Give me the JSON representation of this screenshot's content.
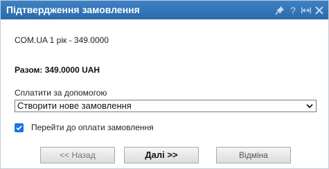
{
  "dialog": {
    "title": "Підтвердження замовлення",
    "icons": [
      "pin-icon",
      "help-icon",
      "resize-icon",
      "close-icon"
    ],
    "help_glyph": "?"
  },
  "order": {
    "product_line": "COM.UA 1 рік - 349.0000",
    "total": "Разом: 349.0000 UAH"
  },
  "payment": {
    "label": "Сплатити за допомогою",
    "selected_option": "Створити нове замовлення"
  },
  "proceed": {
    "label": "Перейти до оплати замовлення",
    "checked": true
  },
  "buttons": {
    "back": "<< Назад",
    "next": "Далі >>",
    "cancel": "Відміна"
  },
  "colors": {
    "titlebar": "#3478bb",
    "checkbox": "#1a73e8"
  }
}
